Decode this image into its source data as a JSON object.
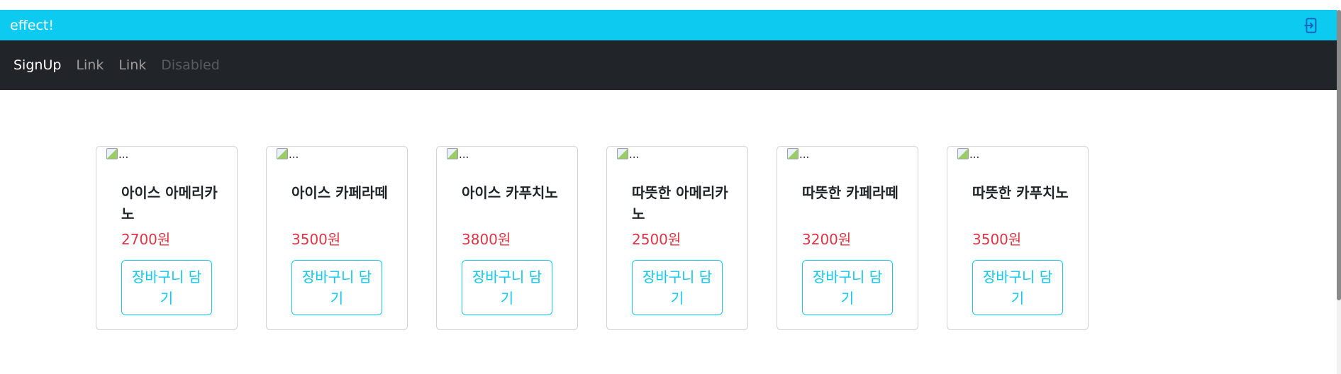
{
  "header": {
    "brand": "effect!",
    "logout_icon": "logout-icon"
  },
  "navbar": {
    "items": [
      {
        "label": "SignUp",
        "state": "active"
      },
      {
        "label": "Link",
        "state": "link"
      },
      {
        "label": "Link",
        "state": "link"
      },
      {
        "label": "Disabled",
        "state": "disabled"
      }
    ]
  },
  "products": [
    {
      "img_alt": "...",
      "title": "아이스 아메리카노",
      "price": "2700원",
      "button": "장바구니 담기"
    },
    {
      "img_alt": "...",
      "title": "아이스 카페라떼",
      "price": "3500원",
      "button": "장바구니 담기"
    },
    {
      "img_alt": "...",
      "title": "아이스 카푸치노",
      "price": "3800원",
      "button": "장바구니 담기"
    },
    {
      "img_alt": "...",
      "title": "따뜻한 아메리카노",
      "price": "2500원",
      "button": "장바구니 담기"
    },
    {
      "img_alt": "...",
      "title": "따뜻한 카페라떼",
      "price": "3200원",
      "button": "장바구니 담기"
    },
    {
      "img_alt": "...",
      "title": "따뜻한 카푸치노",
      "price": "3500원",
      "button": "장바구니 담기"
    }
  ],
  "colors": {
    "header_bg": "#0dcaf0",
    "navbar_bg": "#212529",
    "price": "#dc3545",
    "button_accent": "#0dcaf0"
  }
}
